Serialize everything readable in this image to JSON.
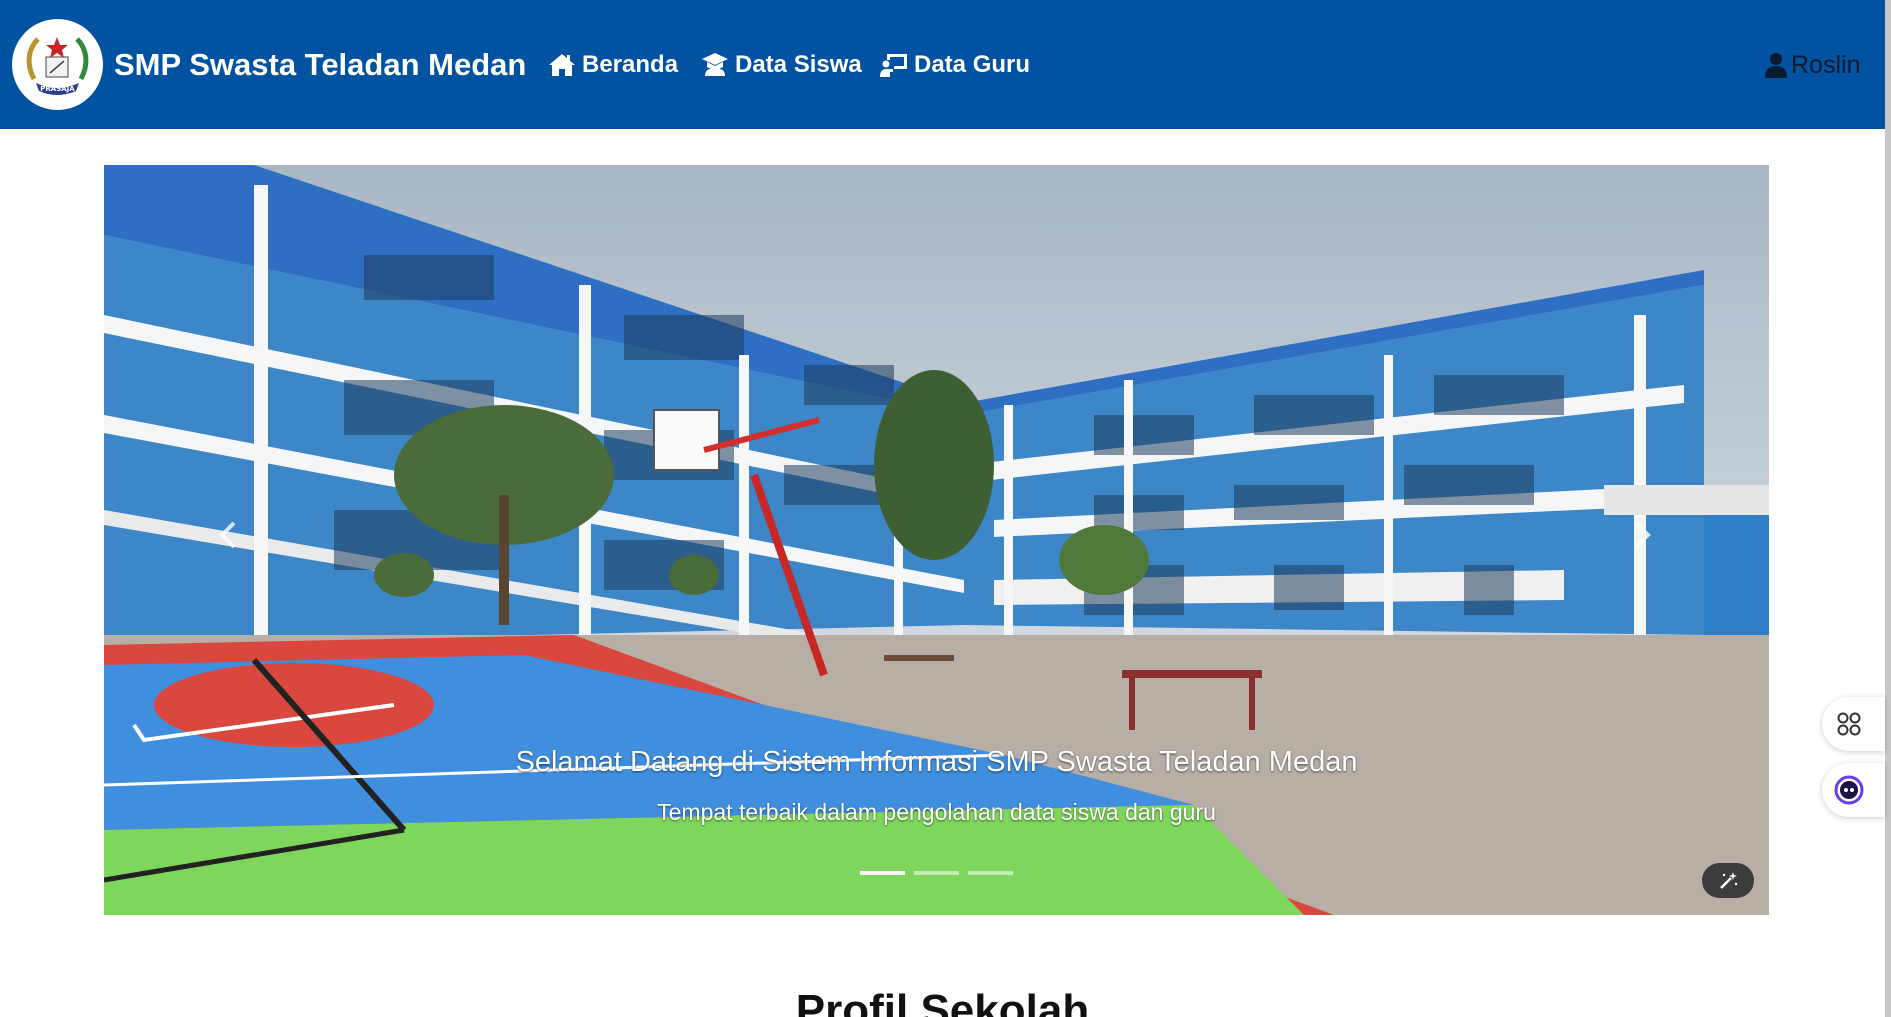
{
  "navbar": {
    "brand": "SMP Swasta Teladan Medan",
    "logo_text": "PRASAJA",
    "items": [
      {
        "label": "Beranda",
        "icon": "home-icon"
      },
      {
        "label": "Data Siswa",
        "icon": "graduate-icon"
      },
      {
        "label": "Data Guru",
        "icon": "teacher-board-icon"
      }
    ],
    "user": {
      "label": "Roslin",
      "icon": "user-icon"
    }
  },
  "carousel": {
    "caption_title": "Selamat Datang di Sistem Informasi SMP Swasta Teladan Medan",
    "caption_text": "Tempat terbaik dalam pengolahan data siswa dan guru",
    "slides_count": 3,
    "active_slide": 1
  },
  "widgets": {
    "apps_icon": "apps-grid-icon",
    "ai_icon": "assistant-face-icon"
  },
  "section": {
    "title": "Profil Sekolah"
  },
  "colors": {
    "navbar": "#0152a1",
    "building": "#3d86c8",
    "court_blue": "#3f8fde",
    "court_red": "#d9473e",
    "court_green": "#7fd65c"
  }
}
